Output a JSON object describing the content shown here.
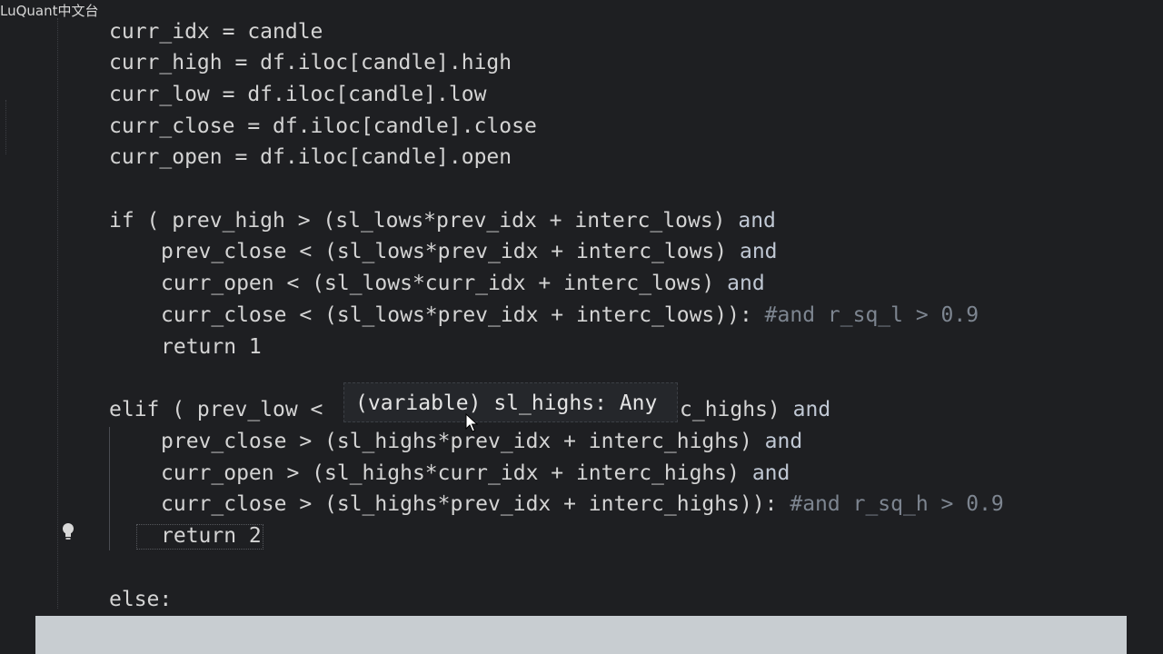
{
  "watermark": "LuQuant中文台",
  "code": {
    "l1": "curr_idx = candle",
    "l2": "curr_high = df.iloc[candle].high",
    "l3": "curr_low = df.iloc[candle].low",
    "l4": "curr_close = df.iloc[candle].close",
    "l5": "curr_open = df.iloc[candle].open",
    "if_code": "if ( prev_high > (sl_lows*prev_idx + interc_lows) ",
    "and_kw": "and",
    "if2_code": "prev_close < (sl_lows*prev_idx + interc_lows) ",
    "if3_code": "curr_open < (sl_lows*curr_idx + interc_lows) ",
    "if4_code": "curr_close < (sl_lows*prev_idx + interc_lows)): ",
    "if4_comment": "#and r_sq_l > 0.9",
    "return1": "return 1",
    "elif_start": "elif ( prev_low < ",
    "elif_end": "c_highs) ",
    "elif2_code": "prev_close > (sl_highs*prev_idx + interc_highs) ",
    "elif3_code": "curr_open > (sl_highs*curr_idx + interc_highs) ",
    "elif4_code": "curr_close > (sl_highs*prev_idx + interc_highs)): ",
    "elif4_comment": "#and r_sq_h > 0.9",
    "return2": "return 2",
    "else": "else:"
  },
  "tooltip": "(variable) sl_highs: Any",
  "icons": {
    "lightbulb": "lightbulb-icon",
    "cursor": "mouse-cursor-icon"
  },
  "colors": {
    "background": "#1e1f22",
    "text": "#d4d4d4",
    "comment": "#7d8590",
    "bottom_bar": "#c8cdd1"
  }
}
